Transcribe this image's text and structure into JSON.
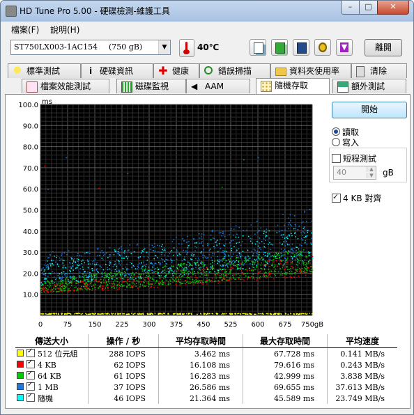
{
  "window": {
    "title": "HD Tune Pro  5.00 - 硬碟檢測-維護工具",
    "controls": {
      "minimize": "–",
      "maximize": "□",
      "close": "✕"
    }
  },
  "menu": [
    {
      "label": "檔案(F)"
    },
    {
      "label": "說明(H)"
    }
  ],
  "toolbar": {
    "drive_model": "ST750LX003-1AC154",
    "drive_size": "(750 gB)",
    "temperature": "40℃",
    "exit_label": "離開",
    "icons": [
      "copy-icon",
      "copy-screenshot-icon",
      "save-icon",
      "options-icon",
      "download-icon"
    ]
  },
  "tabs_row1": [
    {
      "label": "標準測試",
      "icon": "lightbulb-icon"
    },
    {
      "label": "硬碟資訊",
      "icon": "info-icon"
    },
    {
      "label": "健康",
      "icon": "health-cross-icon"
    },
    {
      "label": "錯誤掃描",
      "icon": "magnifier-icon"
    },
    {
      "label": "資料夾使用率",
      "icon": "folder-icon"
    },
    {
      "label": "清除",
      "icon": "trash-icon"
    }
  ],
  "tabs_row2": [
    {
      "label": "檔案效能測試",
      "icon": "file-benchmark-icon"
    },
    {
      "label": "磁碟監視",
      "icon": "monitor-chart-icon"
    },
    {
      "label": "AAM",
      "icon": "speaker-icon"
    },
    {
      "label": "隨機存取",
      "icon": "random-access-icon",
      "active": true
    },
    {
      "label": "額外測試",
      "icon": "extra-tests-icon"
    }
  ],
  "controls": {
    "start_label": "開始",
    "read_label": "讀取",
    "write_label": "寫入",
    "read_selected": true,
    "short_test_label": "短程測試",
    "short_test_checked": false,
    "short_test_value": "40",
    "short_test_unit": "gB",
    "align_label": "4 KB 對齊",
    "align_checked": true
  },
  "chart_data": {
    "type": "scatter",
    "ylabel": "ms",
    "xlabel": "",
    "x_unit": "gB",
    "xlim": [
      0,
      750
    ],
    "ylim": [
      0,
      100
    ],
    "x_ticks": [
      "0",
      "75",
      "150",
      "225",
      "300",
      "375",
      "450",
      "525",
      "600",
      "675",
      "750gB"
    ],
    "y_ticks": [
      "10.0",
      "20.0",
      "30.0",
      "40.0",
      "50.0",
      "60.0",
      "70.0",
      "80.0",
      "90.0",
      "100.0"
    ],
    "grid": true,
    "background": "#000000",
    "series": [
      {
        "name": "512 位元組",
        "color": "#ffff00",
        "band": [
          [
            0,
            0.8,
            1.3
          ],
          [
            750,
            0.8,
            1.3
          ]
        ],
        "count": 300
      },
      {
        "name": "4 KB",
        "color": "#ff0000",
        "band": [
          [
            0,
            11,
            15
          ],
          [
            300,
            13,
            20
          ],
          [
            600,
            17,
            26
          ],
          [
            750,
            19,
            29
          ]
        ],
        "count": 280
      },
      {
        "name": "64 KB",
        "color": "#00cc00",
        "band": [
          [
            0,
            11,
            17
          ],
          [
            300,
            14,
            23
          ],
          [
            600,
            18,
            29
          ],
          [
            750,
            21,
            32
          ]
        ],
        "count": 800
      },
      {
        "name": "1 MB",
        "color": "#1e78dc",
        "band": [
          [
            0,
            17,
            30
          ],
          [
            300,
            20,
            35
          ],
          [
            600,
            25,
            45
          ],
          [
            750,
            28,
            52
          ]
        ],
        "count": 600
      },
      {
        "name": "隨機",
        "color": "#00ffff",
        "band": [
          [
            0,
            15,
            28
          ],
          [
            300,
            18,
            33
          ],
          [
            600,
            23,
            40
          ],
          [
            750,
            26,
            44
          ]
        ],
        "count": 420
      }
    ],
    "outliers": [
      {
        "x": 240,
        "y": 67.5,
        "color": "#1e78dc"
      },
      {
        "x": 160,
        "y": 60.5,
        "color": "#ff0000"
      },
      {
        "x": 500,
        "y": 61,
        "color": "#00cc00"
      },
      {
        "x": 20,
        "y": 60,
        "color": "#1e78dc"
      },
      {
        "x": 10,
        "y": 71,
        "color": "#ff0000"
      },
      {
        "x": 560,
        "y": 74,
        "color": "#00cc00"
      },
      {
        "x": 600,
        "y": 75,
        "color": "#1e78dc"
      },
      {
        "x": 70,
        "y": 75,
        "color": "#1e78dc"
      }
    ]
  },
  "table": {
    "headers": [
      "傳送大小",
      "操作 / 秒",
      "平均存取時間",
      "最大存取時間",
      "平均速度"
    ],
    "rows": [
      {
        "size": "512 位元組",
        "color": "#ffff00",
        "ops": "288 IOPS",
        "avg": "3.462 ms",
        "max": "67.728 ms",
        "speed": "0.141 MB/s"
      },
      {
        "size": "4 KB",
        "color": "#ff0000",
        "ops": "62 IOPS",
        "avg": "16.108 ms",
        "max": "79.616 ms",
        "speed": "0.243 MB/s"
      },
      {
        "size": "64 KB",
        "color": "#00cc00",
        "ops": "61 IOPS",
        "avg": "16.283 ms",
        "max": "42.999 ms",
        "speed": "3.838 MB/s"
      },
      {
        "size": "1 MB",
        "color": "#1e78dc",
        "ops": "37 IOPS",
        "avg": "26.586 ms",
        "max": "69.655 ms",
        "speed": "37.613 MB/s"
      },
      {
        "size": "隨機",
        "color": "#00ffff",
        "ops": "46 IOPS",
        "avg": "21.364 ms",
        "max": "45.589 ms",
        "speed": "23.749 MB/s"
      }
    ]
  }
}
